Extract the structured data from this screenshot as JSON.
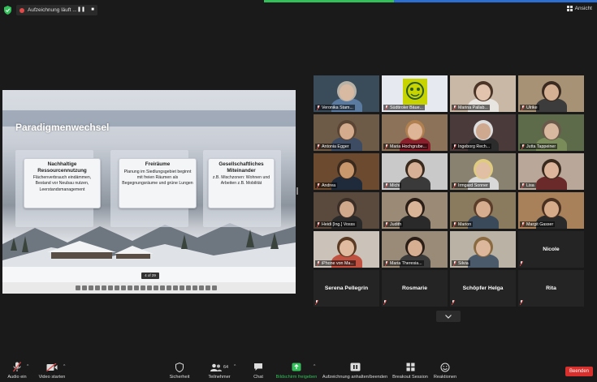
{
  "topbar": {
    "recording_label": "Aufzeichnung läuft ...",
    "pause_label": "❚❚",
    "stop_label": "■",
    "view_label": "Ansicht"
  },
  "slide": {
    "title": "Paradigmenwechsel",
    "counter": "4 of 29",
    "cards": [
      {
        "title": "Nachhaltige Ressourcennutzung",
        "text": "Flächenverbrauch eindämmen, Bestand vor Neubau nutzen, Leerstandsmanagement"
      },
      {
        "title": "Freiräume",
        "text": "Planung im Siedlungsgebiet beginnt mit freien Räumen als Begegnungsräume und grüne Lungen"
      },
      {
        "title": "Gesellschaftliches Miteinander",
        "text": "z.B. Mischzonen: Wohnen und Arbeiten z.B. Mobilität"
      }
    ]
  },
  "participants": [
    {
      "name": "Veronika Stam...",
      "bg": "#3a4b5a",
      "skin": "#d8b9a2",
      "hair": "#b9b2a6",
      "shirt": "#5a7aa0"
    },
    {
      "name": "Südtiroler Bäue...",
      "bg": "#e6e9ef",
      "logo": true
    },
    {
      "name": "Marina Pallab...",
      "bg": "#c9b8a6",
      "skin": "#e2c3ad",
      "hair": "#4a3426",
      "shirt": "#e8e4df"
    },
    {
      "name": "Ulrike",
      "bg": "#a89276",
      "skin": "#d6b092",
      "hair": "#3a2a20",
      "shirt": "#3c3c3c"
    },
    {
      "name": "Antonia Egger",
      "bg": "#6d5a47",
      "skin": "#d4ab8c",
      "hair": "#5a4535",
      "shirt": "#3d4c63"
    },
    {
      "name": "Maria Hochgrube...",
      "bg": "#8c7258",
      "skin": "#dfb597",
      "hair": "#b08050",
      "shirt": "#8a1f2b",
      "speaking": true
    },
    {
      "name": "Ingeborg Rech...",
      "bg": "#4b3a3a",
      "skin": "#cfa890",
      "hair": "#ddd",
      "shirt": "#2c2c2c"
    },
    {
      "name": "Jutta Tappeiner",
      "bg": "#5e6b4a",
      "skin": "#d9b8a0",
      "hair": "#6a5a4a",
      "shirt": "#7a8c5a"
    },
    {
      "name": "Andrea",
      "bg": "#6b4a30",
      "skin": "#c9976c",
      "hair": "#3a2a1e",
      "shirt": "#1f2a3a"
    },
    {
      "name": "Michi",
      "bg": "#c9c9c9",
      "skin": "#d8b095",
      "hair": "#3a2a1e",
      "shirt": "#3a3a3a"
    },
    {
      "name": "Irmgard Sonner",
      "bg": "#8a8270",
      "skin": "#e0bfa5",
      "hair": "#e0cc80",
      "shirt": "#d9d9d9"
    },
    {
      "name": "Lisa",
      "bg": "#b9a89a",
      "skin": "#dcb59a",
      "hair": "#3a2a1e",
      "shirt": "#6a2a2a"
    },
    {
      "name": "Heidi [Ing.] Vosss",
      "bg": "#5a4a3e",
      "skin": "#d0a88c",
      "hair": "#3a2e26",
      "shirt": "#2a2a2a"
    },
    {
      "name": "Judith",
      "bg": "#9a8a76",
      "skin": "#d9b497",
      "hair": "#2a1e16",
      "shirt": "#2a2a2a"
    },
    {
      "name": "Marion",
      "bg": "#8a7a5e",
      "skin": "#d6ad8e",
      "hair": "#5a3e2a",
      "shirt": "#3a4a5a"
    },
    {
      "name": "Margit Gasser",
      "bg": "#a8805a",
      "skin": "#d6ab8a",
      "hair": "#4a3020",
      "shirt": "#2a2a2a"
    },
    {
      "name": "iPhone von Ma...",
      "bg": "#cbc3ba",
      "skin": "#e0bba0",
      "hair": "#5a3a22",
      "shirt": "#c05040"
    },
    {
      "name": "Maria Theresia...",
      "bg": "#9a8a78",
      "skin": "#d6ae92",
      "hair": "#2a1e16",
      "shirt": "#3a3a3a"
    },
    {
      "name": "Silvia",
      "bg": "#bab2a4",
      "skin": "#dcb79c",
      "hair": "#8a6a40",
      "shirt": "#4a5a6a"
    },
    {
      "name": "Nicole",
      "nameonly": true
    },
    {
      "name": "Serena Pellegrin",
      "nameonly": true
    },
    {
      "name": "Rosmarie",
      "nameonly": true
    },
    {
      "name": "Schöpfer Helga",
      "nameonly": true
    },
    {
      "name": "Rita",
      "nameonly": true
    }
  ],
  "toolbar": {
    "audio_label": "Audio ein",
    "video_label": "Video starten",
    "security_label": "Sicherheit",
    "participants_label": "Teilnehmer",
    "participants_count": "64",
    "chat_label": "Chat",
    "share_label": "Bildschirm freigeben",
    "record_label": "Aufzeichnung anhalten/beenden",
    "breakout_label": "Breakout Session",
    "reactions_label": "Reaktionen",
    "end_label": "Beenden"
  },
  "colors": {
    "accent_green": "#33c05a",
    "end_red": "#d8302d",
    "speaking_outline": "#c9d63a",
    "muted_red": "#e14a4a"
  }
}
